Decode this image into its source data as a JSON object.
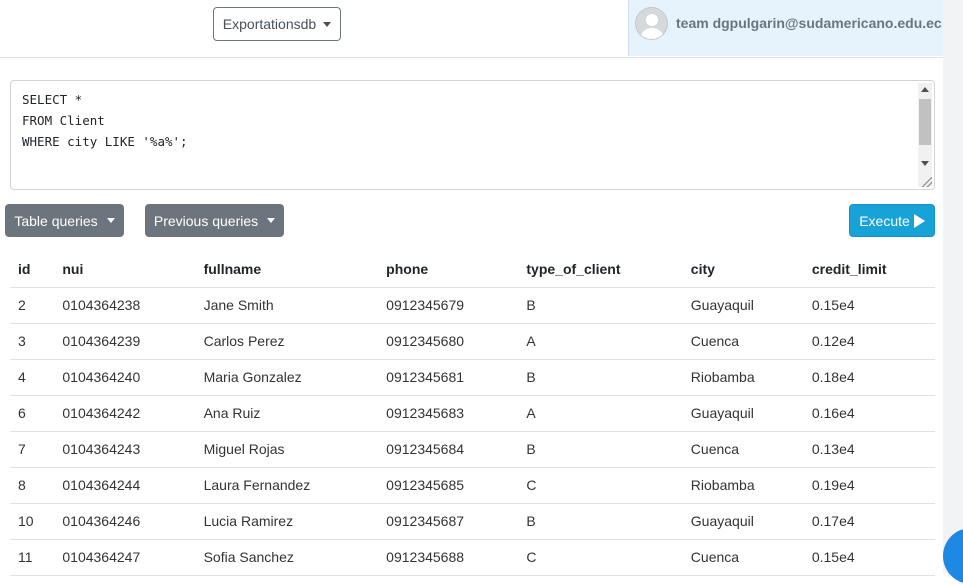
{
  "header": {
    "database_label": "Exportationsdb",
    "user_label": "team dgpulgarin@sudamericano.edu.ec"
  },
  "editor": {
    "query": "SELECT *\nFROM Client\nWHERE city LIKE '%a%';"
  },
  "toolbar": {
    "table_queries_label": "Table queries",
    "previous_queries_label": "Previous queries",
    "execute_label": "Execute"
  },
  "results": {
    "columns": [
      "id",
      "nui",
      "fullname",
      "phone",
      "type_of_client",
      "city",
      "credit_limit"
    ],
    "rows": [
      [
        "2",
        "0104364238",
        "Jane Smith",
        "0912345679",
        "B",
        "Guayaquil",
        "0.15e4"
      ],
      [
        "3",
        "0104364239",
        "Carlos Perez",
        "0912345680",
        "A",
        "Cuenca",
        "0.12e4"
      ],
      [
        "4",
        "0104364240",
        "Maria Gonzalez",
        "0912345681",
        "B",
        "Riobamba",
        "0.18e4"
      ],
      [
        "6",
        "0104364242",
        "Ana Ruiz",
        "0912345683",
        "A",
        "Guayaquil",
        "0.16e4"
      ],
      [
        "7",
        "0104364243",
        "Miguel Rojas",
        "0912345684",
        "B",
        "Cuenca",
        "0.13e4"
      ],
      [
        "8",
        "0104364244",
        "Laura Fernandez",
        "0912345685",
        "C",
        "Riobamba",
        "0.19e4"
      ],
      [
        "10",
        "0104364246",
        "Lucia Ramirez",
        "0912345687",
        "B",
        "Guayaquil",
        "0.17e4"
      ],
      [
        "11",
        "0104364247",
        "Sofia Sanchez",
        "0912345688",
        "C",
        "Cuenca",
        "0.15e4"
      ]
    ]
  },
  "colors": {
    "secondary": "#6c757d",
    "info": "#17a2d8",
    "user_bg": "#e7f3fc"
  }
}
